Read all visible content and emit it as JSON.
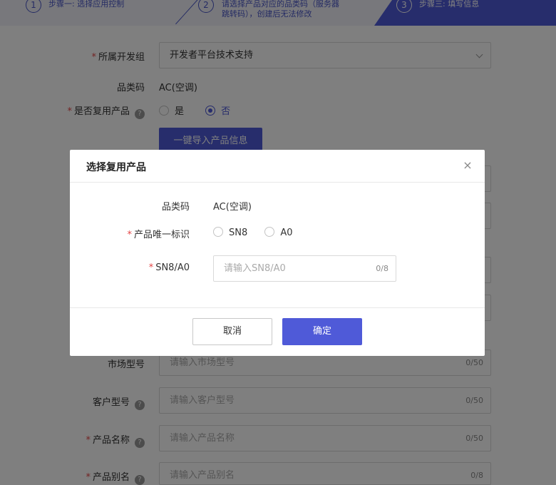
{
  "steps": [
    {
      "num": "1",
      "text": "步骤一: 选择应用控制"
    },
    {
      "num": "2",
      "text_line1": "请选择产品对应的品类码（服务器",
      "text_line2": "跳转码），创建后无法修改"
    },
    {
      "num": "3",
      "text": "步骤三: 填写信息"
    }
  ],
  "form": {
    "dev_group": {
      "label": "所属开发组",
      "value": "开发者平台技术支持"
    },
    "category_code": {
      "label": "品类码",
      "value": "AC(空调)"
    },
    "reuse_product": {
      "label": "是否复用产品",
      "option_yes": "是",
      "option_no": "否",
      "selected": "否"
    },
    "import_button": "一键导入产品信息",
    "market_model": {
      "label": "市场型号",
      "placeholder": "请输入市场型号",
      "counter": "0/50"
    },
    "customer_model": {
      "label": "客户型号",
      "placeholder": "请输入客户型号",
      "counter": "0/50"
    },
    "product_name": {
      "label": "产品名称",
      "placeholder": "请输入产品名称",
      "counter": "0/50"
    },
    "product_alias": {
      "label": "产品别名",
      "placeholder": "请输入产品别名",
      "counter": "0/8"
    }
  },
  "modal": {
    "title": "选择复用产品",
    "close_icon": "×",
    "category_code": {
      "label": "品类码",
      "value": "AC(空调)"
    },
    "unique_id": {
      "label": "产品唯一标识",
      "option_sn8": "SN8",
      "option_a0": "A0"
    },
    "sn8_input": {
      "label": "SN8/A0",
      "placeholder": "请输入SN8/A0",
      "counter": "0/8"
    },
    "cancel_label": "取消",
    "ok_label": "确定"
  },
  "help_icon_glyph": "?",
  "required_mark": "*",
  "colors": {
    "primary": "#4f5ad8",
    "required": "#e54545"
  }
}
